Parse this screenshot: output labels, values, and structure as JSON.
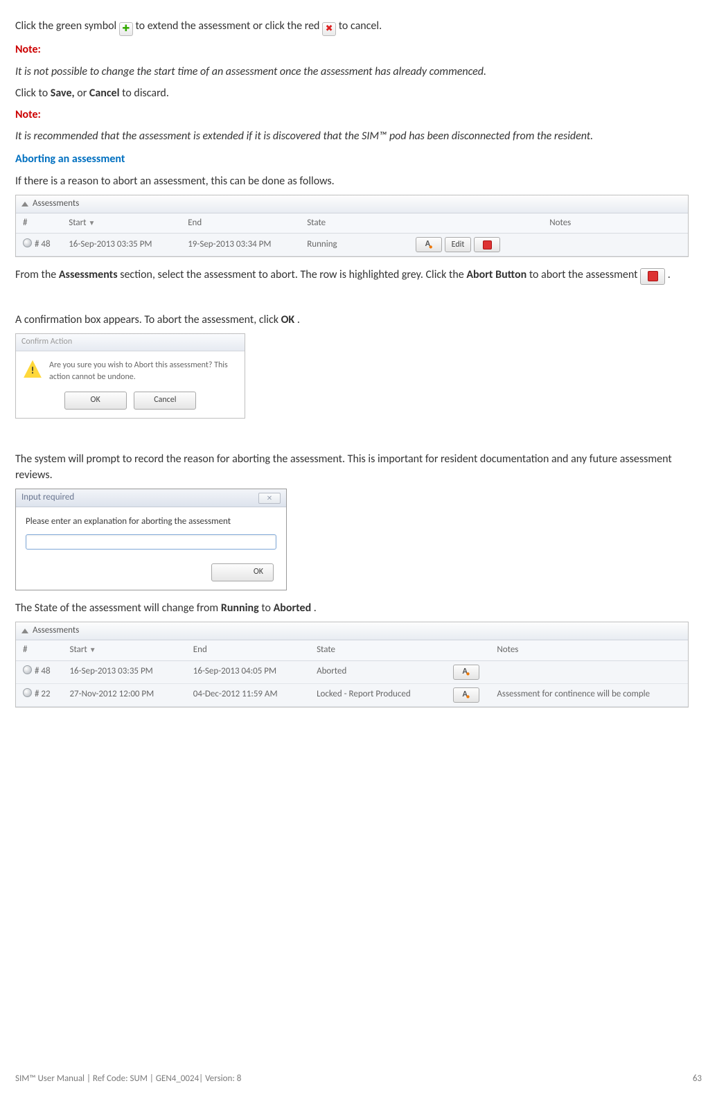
{
  "intro": {
    "line1_a": "Click the green symbol ",
    "line1_b": " to extend the assessment or click the red ",
    "line1_c": "to cancel.",
    "note_label": "Note:",
    "note1_text": "It is not possible to change the start time of an assessment once the assessment has already commenced.",
    "save_cancel_a": "Click to ",
    "save_cancel_b": "Save,",
    "save_cancel_c": " or ",
    "save_cancel_d": "Cancel",
    "save_cancel_e": " to discard.",
    "note2_text": "It is recommended that the assessment is extended if it is discovered that the SIM™ pod has been disconnected from the resident.",
    "aborting_heading": "Aborting an assessment",
    "abort_intro": "If there is a reason to abort an assessment, this can be done as follows."
  },
  "panel1": {
    "title": "Assessments",
    "headers": {
      "num": "#",
      "start": "Start",
      "end": "End",
      "state": "State",
      "notes": "Notes"
    },
    "row": {
      "num": "# 48",
      "start": "16-Sep-2013 03:35 PM",
      "end": "19-Sep-2013 03:34 PM",
      "state": "Running",
      "edit_label": "Edit"
    }
  },
  "after_panel1": {
    "p_a": "From the ",
    "p_b": "Assessments",
    "p_c": " section, select the assessment to abort. The row is highlighted grey. Click the ",
    "p_d": "Abort Button",
    "p_e": " to abort the assessment",
    "p_f": " .",
    "confirm_intro": "A confirmation box appears. To abort the assessment, click ",
    "confirm_intro_b": "OK",
    "confirm_intro_c": "."
  },
  "confirm_dialog": {
    "title": "Confirm Action",
    "message": "Are you sure you wish to Abort this assessment? This action cannot be undone.",
    "ok": "OK",
    "cancel": "Cancel"
  },
  "reason_para": "The system will prompt to record the reason for aborting the assessment. This is important for resident documentation and any future assessment reviews.",
  "input_dialog": {
    "title": "Input required",
    "prompt": "Please enter an explanation for aborting the assessment",
    "ok": "OK"
  },
  "state_change": {
    "a": "The State of the assessment will change from ",
    "b": "Running",
    "c": " to ",
    "d": "Aborted",
    "e": "."
  },
  "panel2": {
    "title": "Assessments",
    "headers": {
      "num": "#",
      "start": "Start",
      "end": "End",
      "state": "State",
      "notes": "Notes"
    },
    "rows": [
      {
        "num": "# 48",
        "start": "16-Sep-2013 03:35 PM",
        "end": "16-Sep-2013 04:05 PM",
        "state": "Aborted",
        "notes": ""
      },
      {
        "num": "# 22",
        "start": "27-Nov-2012 12:00 PM",
        "end": "04-Dec-2012 11:59 AM",
        "state": "Locked - Report Produced",
        "notes": "Assessment for continence will be comple"
      }
    ]
  },
  "footer": {
    "left": "SIM™ User Manual | Ref Code: SUM | GEN4_0024| Version: 8",
    "right": "63"
  }
}
